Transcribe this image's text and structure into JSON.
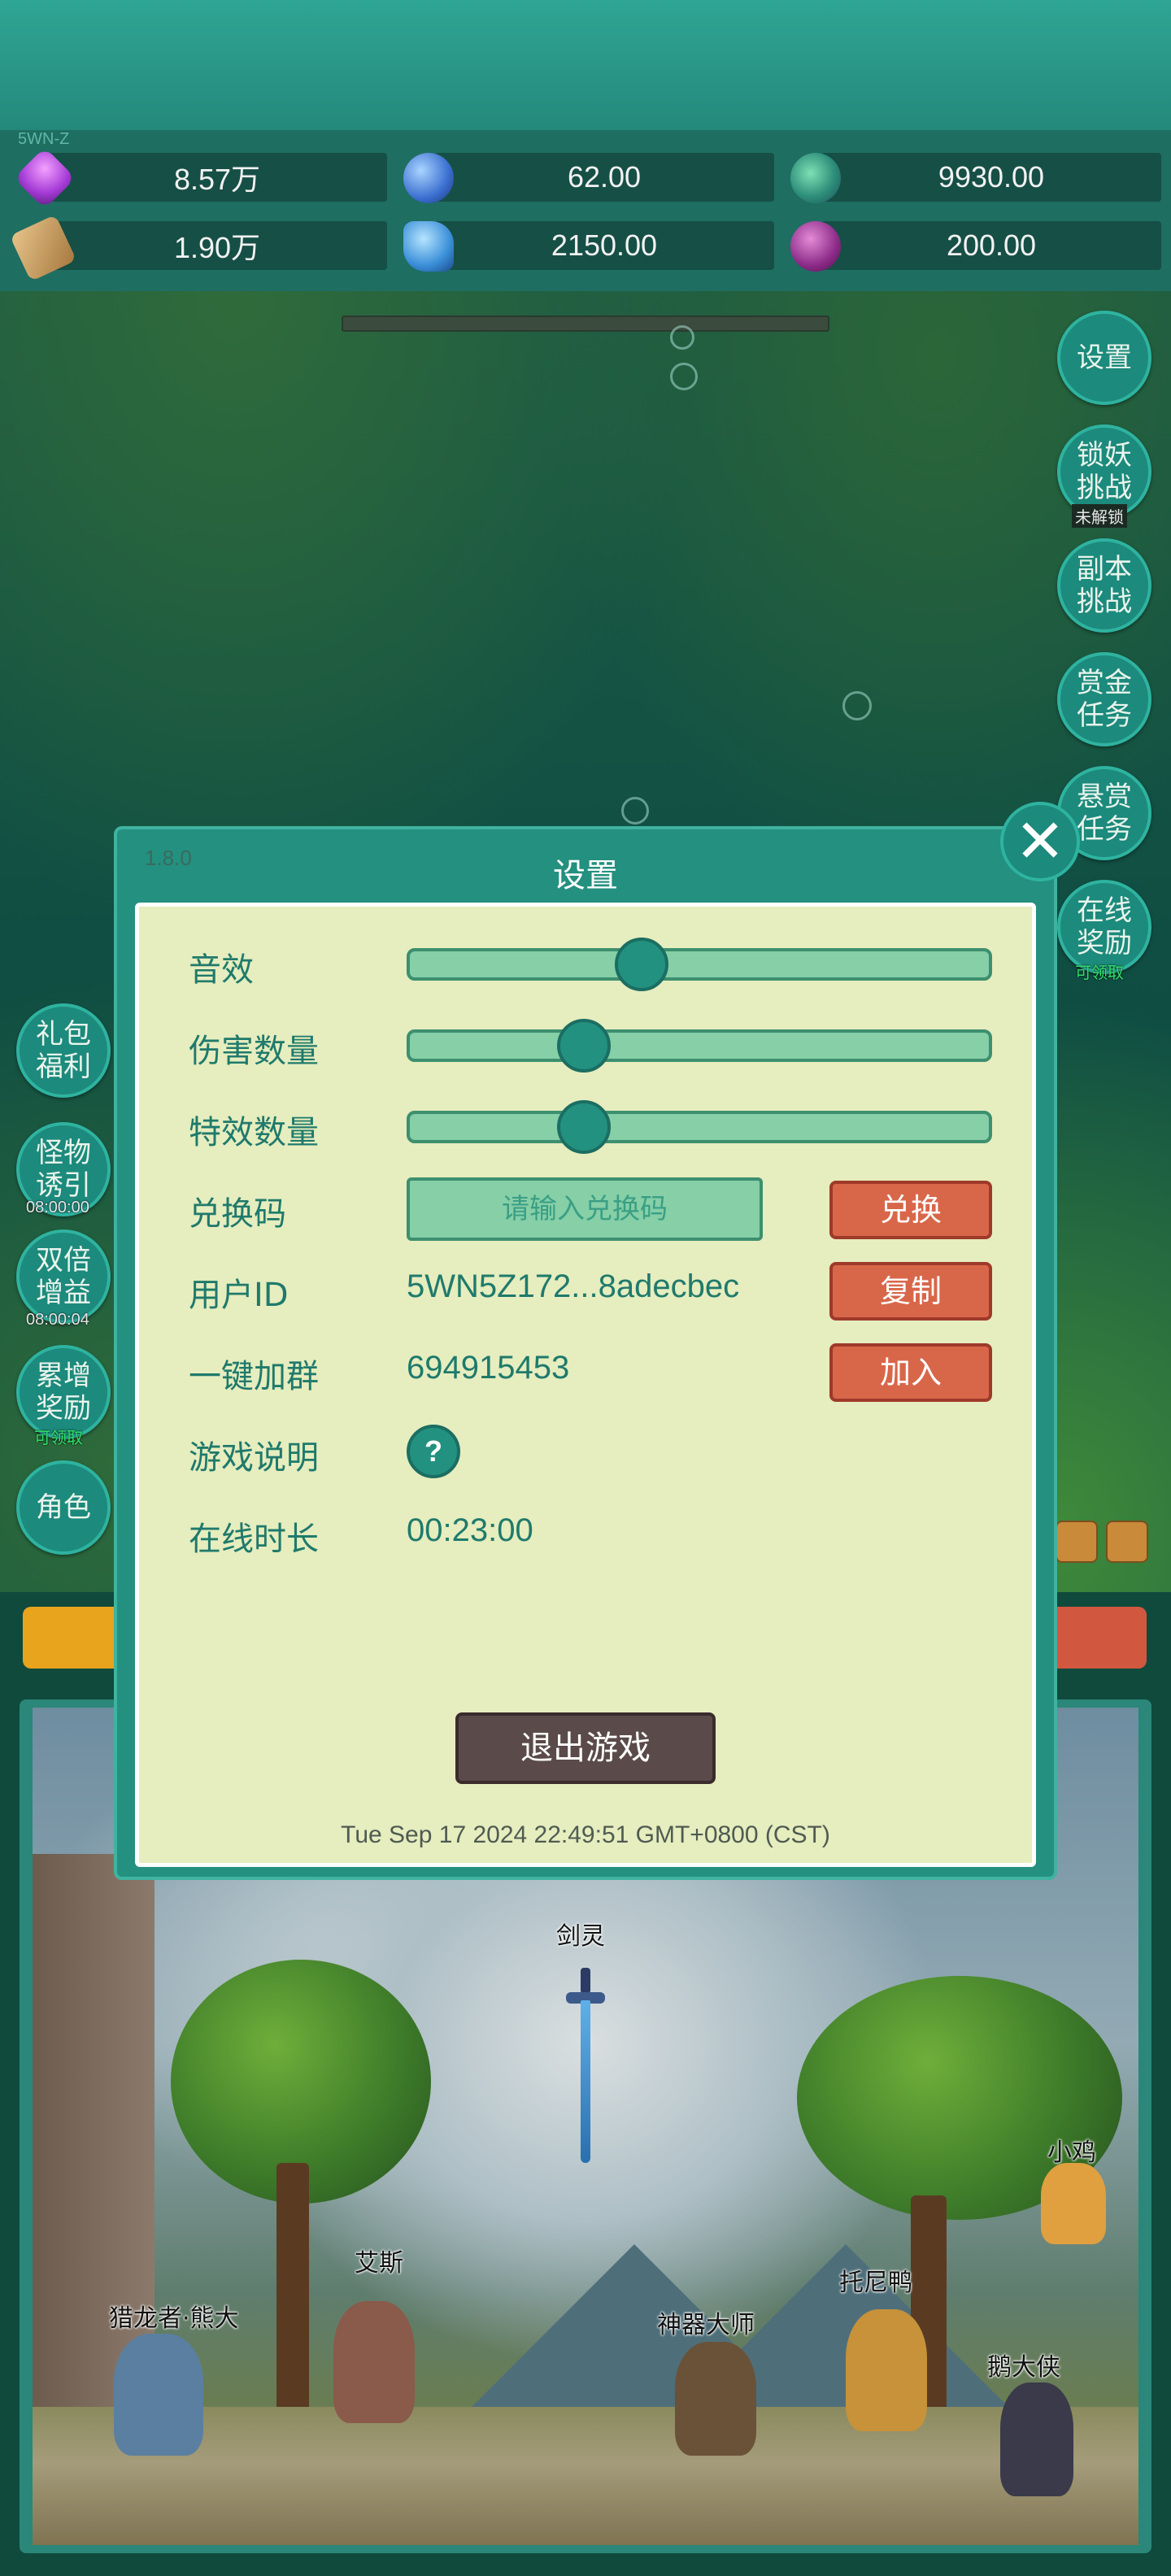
{
  "header": {
    "tag": "5WN-Z"
  },
  "resources": [
    {
      "icon": "purple-gem-icon",
      "value": "8.57万"
    },
    {
      "icon": "blue-orb-icon",
      "value": "62.00"
    },
    {
      "icon": "green-globe-icon",
      "value": "9930.00"
    },
    {
      "icon": "scroll-icon",
      "value": "1.90万"
    },
    {
      "icon": "blue-crystal-icon",
      "value": "2150.00"
    },
    {
      "icon": "purple-fruit-icon",
      "value": "200.00"
    }
  ],
  "right_menu": [
    {
      "label": "设置",
      "sub": ""
    },
    {
      "label": "锁妖\n挑战",
      "sub": "未解锁"
    },
    {
      "label": "副本\n挑战",
      "sub": ""
    },
    {
      "label": "赏金\n任务",
      "sub": ""
    },
    {
      "label": "悬赏\n任务",
      "sub": ""
    },
    {
      "label": "在线\n奖励",
      "sub": "可领取"
    }
  ],
  "left_menu": [
    {
      "label": "礼包\n福利",
      "sub": ""
    },
    {
      "label": "怪物\n诱引",
      "sub": "08:00:00"
    },
    {
      "label": "双倍\n增益",
      "sub": "08:00:04"
    },
    {
      "label": "累增\n奖励",
      "sub": "可领取"
    },
    {
      "label": "角色",
      "sub": ""
    }
  ],
  "scene": {
    "characters": [
      "剑灵",
      "艾斯",
      "猎龙者·熊大",
      "神器大师",
      "托尼鸭",
      "小鸡",
      "鹅大侠"
    ]
  },
  "settings_modal": {
    "version": "1.8.0",
    "title": "设置",
    "sound_label": "音效",
    "sound_level": 0.4,
    "damage_label": "伤害数量",
    "damage_level": 0.3,
    "effects_label": "特效数量",
    "effects_level": 0.3,
    "redeem_label": "兑换码",
    "redeem_placeholder": "请输入兑换码",
    "redeem_button": "兑换",
    "user_id_label": "用户ID",
    "user_id_value": "5WN5Z172...8adecbec",
    "copy_button": "复制",
    "group_label": "一键加群",
    "group_value": "694915453",
    "join_button": "加入",
    "guide_label": "游戏说明",
    "guide_button": "?",
    "online_label": "在线时长",
    "online_value": "00:23:00",
    "exit_button": "退出游戏",
    "timestamp": "Tue Sep 17 2024 22:49:51 GMT+0800 (CST)"
  },
  "colors": {
    "panel_bg": "#e6edbe",
    "teal": "#24907f",
    "accent_red": "#d8674a",
    "text_teal": "#1f7a6c"
  }
}
